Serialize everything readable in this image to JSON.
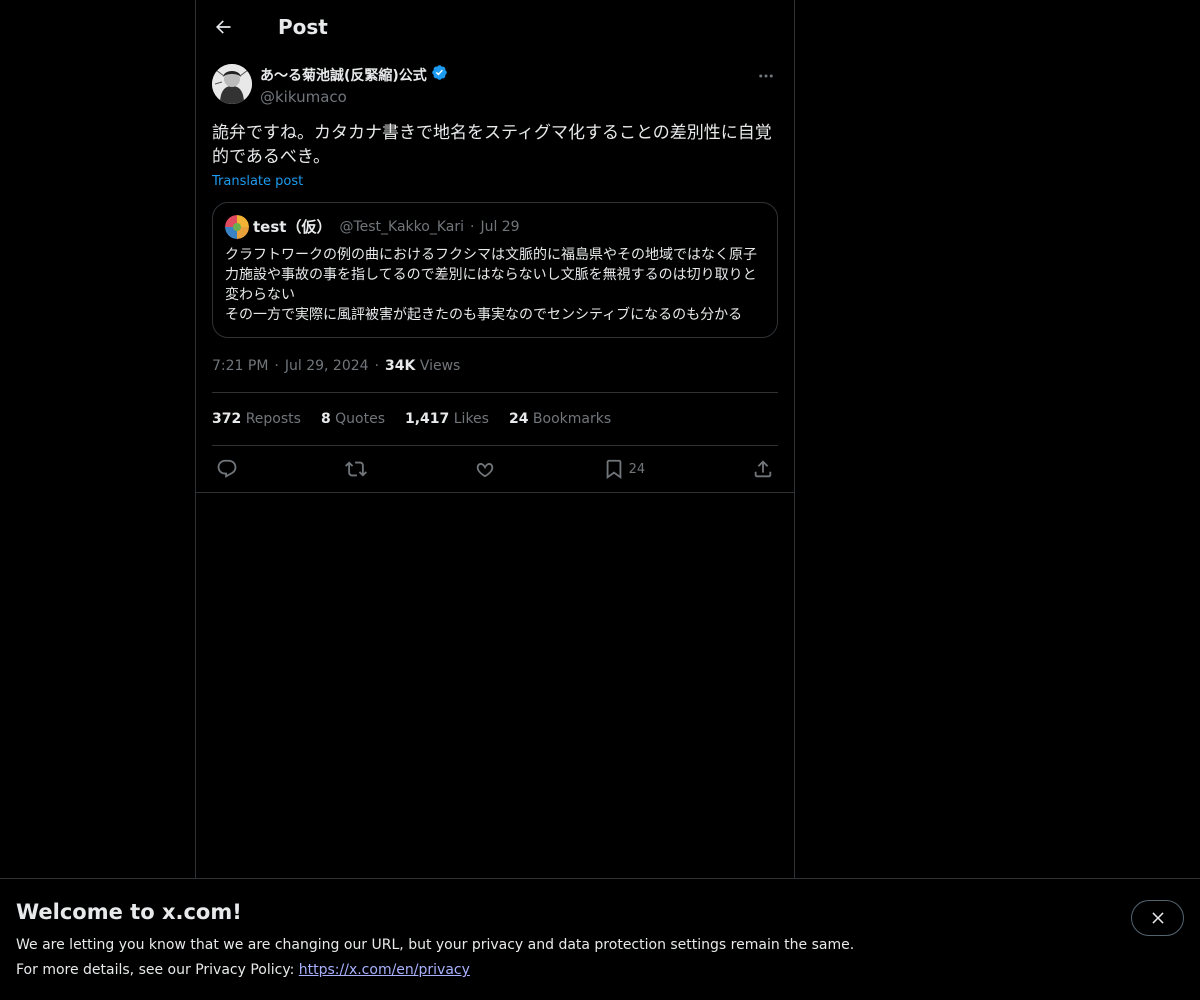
{
  "header": {
    "title": "Post"
  },
  "post": {
    "author_name": "あ〜る菊池誠(反緊縮)公式",
    "handle": "@kikumaco",
    "text": "詭弁ですね。カタカナ書きで地名をスティグマ化することの差別性に自覚的であるべき。",
    "translate_label": "Translate post",
    "quote": {
      "name": "test（仮）",
      "handle": "@Test_Kakko_Kari",
      "dot": "·",
      "date": "Jul 29",
      "text": "クラフトワークの例の曲におけるフクシマは文脈的に福島県やその地域ではなく原子力施設や事故の事を指してるので差別にはならないし文脈を無視するのは切り取りと変わらない\nその一方で実際に風評被害が起きたのも事実なのでセンシティブになるのも分かる"
    },
    "time": "7:21 PM",
    "dot": "·",
    "date": "Jul 29, 2024",
    "views_count": "34K",
    "views_label": "Views"
  },
  "stats": {
    "reposts_count": "372",
    "reposts_label": "Reposts",
    "quotes_count": "8",
    "quotes_label": "Quotes",
    "likes_count": "1,417",
    "likes_label": "Likes",
    "bookmarks_count": "24",
    "bookmarks_label": "Bookmarks"
  },
  "actions": {
    "bookmark_count": "24"
  },
  "banner": {
    "title": "Welcome to x.com!",
    "line1": "We are letting you know that we are changing our URL, but your privacy and data protection settings remain the same.",
    "line2_prefix": "For more details, see our Privacy Policy: ",
    "link": "https://x.com/en/privacy"
  },
  "colors": {
    "accent": "#1d9bf0",
    "muted": "#71767b",
    "border": "#2f3336",
    "text": "#e7e9ea"
  }
}
